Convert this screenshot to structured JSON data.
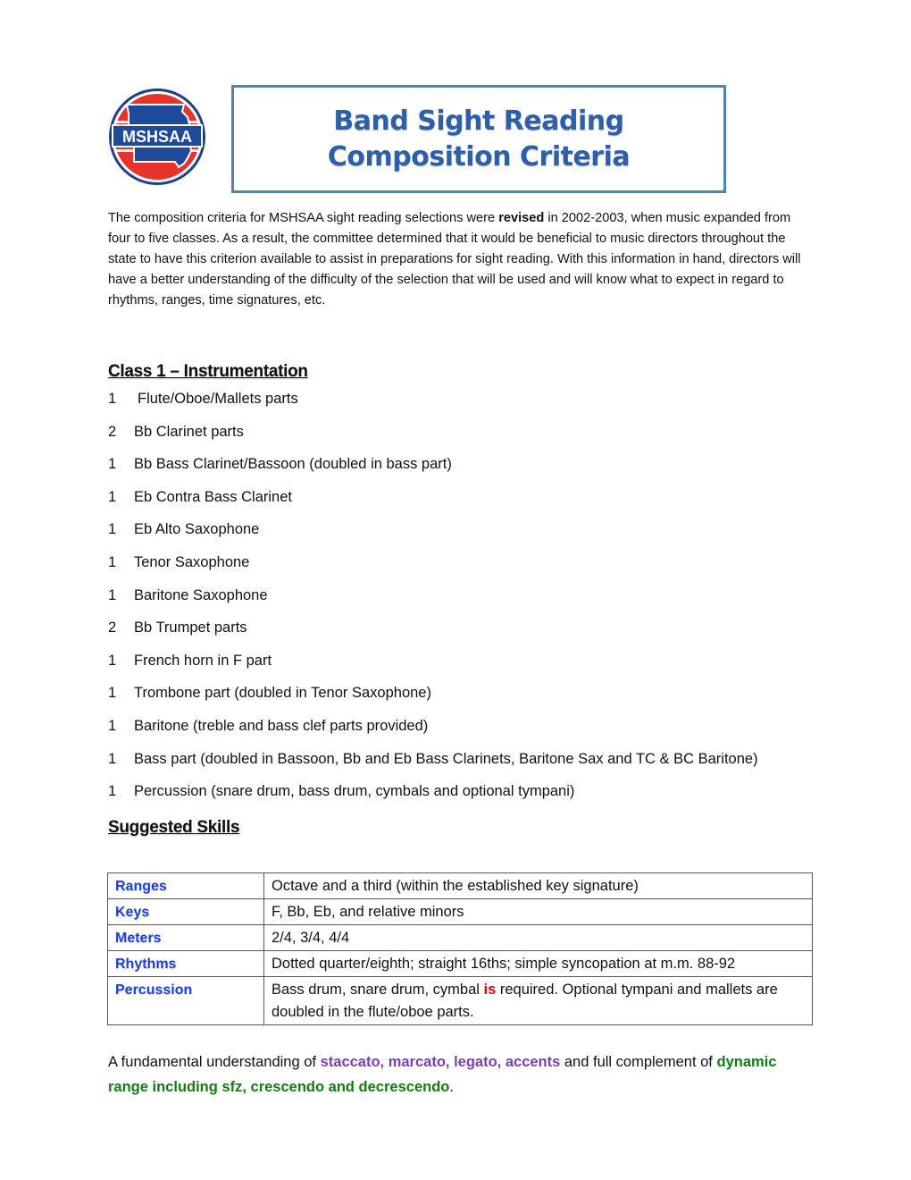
{
  "logo": {
    "text": "MSHSAA",
    "colors": {
      "ring_red": "#e8332b",
      "state_blue": "#1f4a9a",
      "outline": "#1f3f8a"
    }
  },
  "title": {
    "line1": "Band Sight Reading",
    "line2": "Composition Criteria",
    "border_color": "#4f81bd",
    "text_color": "#2e5fab"
  },
  "intro": {
    "before": "The composition criteria for MSHSAA sight reading selections were ",
    "bold": "revised",
    "after": " in 2002-2003, when music expanded from four to five classes.  As a result, the committee determined that it would be beneficial to music directors throughout the state to have this criterion available to assist in preparations for sight reading.  With this information in hand, directors will have a better understanding of the difficulty of the selection that will be used and will know what to expect in regard to rhythms, ranges, time signatures, etc."
  },
  "instrumentation": {
    "heading": "Class 1 – Instrumentation",
    "items": [
      {
        "qty": "1",
        "name": "Flute/Oboe/Mallets parts"
      },
      {
        "qty": "2",
        "name": "Bb Clarinet parts"
      },
      {
        "qty": "1",
        "name": "Bb Bass Clarinet/Bassoon (doubled in bass part)"
      },
      {
        "qty": "1",
        "name": "Eb Contra Bass Clarinet"
      },
      {
        "qty": "1",
        "name": "Eb Alto Saxophone"
      },
      {
        "qty": "1",
        "name": "Tenor Saxophone"
      },
      {
        "qty": "1",
        "name": "Baritone Saxophone"
      },
      {
        "qty": "2",
        "name": "Bb Trumpet parts"
      },
      {
        "qty": "1",
        "name": "French horn in F part"
      },
      {
        "qty": "1",
        "name": "Trombone part (doubled in Tenor Saxophone)"
      },
      {
        "qty": "1",
        "name": "Baritone (treble and bass clef parts provided)"
      },
      {
        "qty": "1",
        "name": "Bass part (doubled in Bassoon, Bb and Eb Bass Clarinets, Baritone Sax and TC & BC Baritone)"
      },
      {
        "qty": "1",
        "name": "Percussion (snare drum, bass drum, cymbals and optional tympani)"
      }
    ]
  },
  "skills": {
    "heading": "Suggested Skills",
    "rows": [
      {
        "label": "Ranges",
        "value": "Octave and a third (within the established key signature)"
      },
      {
        "label": "Keys",
        "value": "F, Bb, Eb, and relative minors"
      },
      {
        "label": "Meters",
        "value": "2/4, 3/4, 4/4"
      },
      {
        "label": "Rhythms",
        "value": "Dotted quarter/eighth; straight 16ths; simple syncopation at m.m. 88-92"
      }
    ],
    "percussion": {
      "label": "Percussion",
      "before": "Bass drum, snare drum, cymbal ",
      "emphasis": "is",
      "after": " required.  Optional tympani and mallets are doubled in the flute/oboe parts."
    },
    "label_color": "#1f3fe0"
  },
  "closing": {
    "before": "A fundamental understanding of ",
    "articulations": "staccato, marcato, legato, accents",
    "middle": " and full complement of ",
    "dynamics": "dynamic range including sfz, crescendo and decrescendo",
    "end": ".",
    "articulation_color": "#7a3fb0",
    "dynamics_color": "#167a16"
  }
}
